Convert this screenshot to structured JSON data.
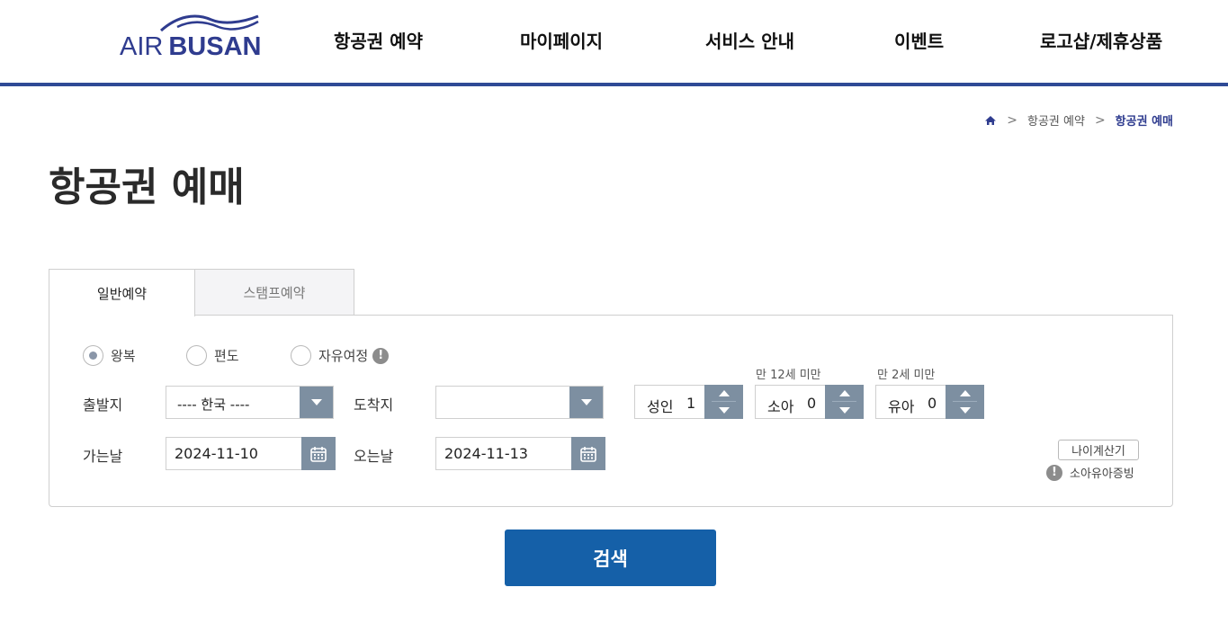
{
  "header": {
    "logo": {
      "air": "AIR",
      "busan": "BUSAN",
      "brand_color": "#2f3c8f"
    },
    "nav": [
      "항공권 예약",
      "마이페이지",
      "서비스 안내",
      "이벤트",
      "로고샵/제휴상품"
    ],
    "accent_bar_color": "#2f4a96"
  },
  "breadcrumb": {
    "icon": "home-icon",
    "items": [
      "항공권 예약",
      "항공권 예매"
    ]
  },
  "page_title": "항공권 예매",
  "tabs": [
    {
      "label": "일반예약",
      "active": true
    },
    {
      "label": "스탬프예약",
      "active": false
    }
  ],
  "trip_type": {
    "options": [
      "왕복",
      "편도",
      "자유여정"
    ],
    "selected": "왕복"
  },
  "origin": {
    "label": "출발지",
    "value": "---- 한국 ----"
  },
  "destination": {
    "label": "도착지",
    "value": ""
  },
  "passengers": {
    "adult": {
      "label": "성인",
      "count": "1"
    },
    "child": {
      "label": "소아",
      "count": "0",
      "hint": "만 12세 미만"
    },
    "infant": {
      "label": "유아",
      "count": "0",
      "hint": "만 2세 미만"
    }
  },
  "depart_date": {
    "label": "가는날",
    "value": "2024-11-10"
  },
  "return_date": {
    "label": "오는날",
    "value": "2024-11-13"
  },
  "age_calculator": "나이계산기",
  "child_infant_proof": "소아유아증빙",
  "search_button": "검색",
  "colors": {
    "control_gray_blue": "#7d8fa1",
    "search_button": "#1560a8"
  }
}
